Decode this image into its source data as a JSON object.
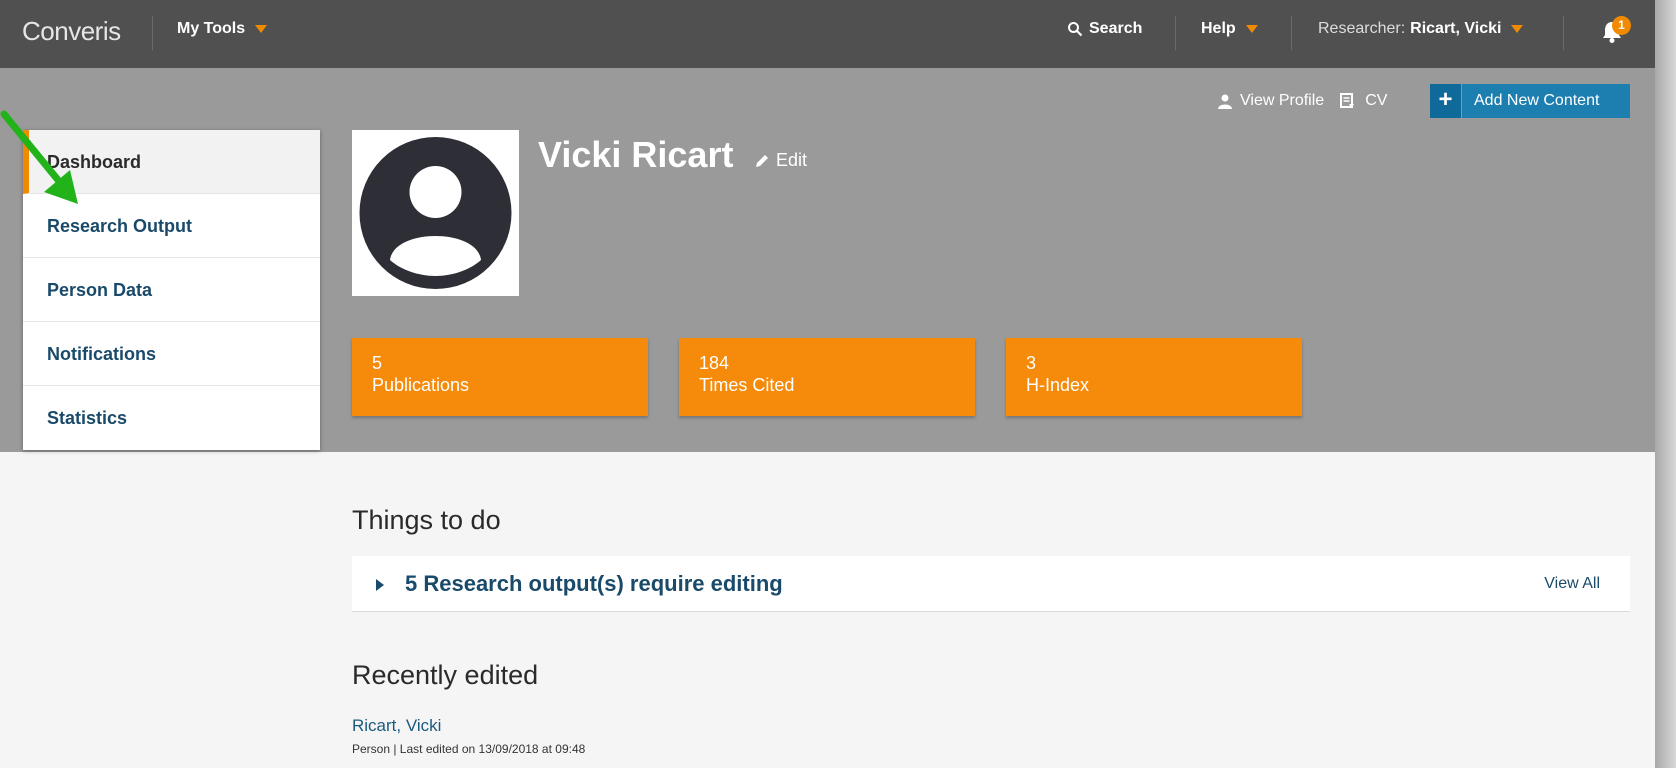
{
  "topbar": {
    "brand": "Converis",
    "my_tools": "My Tools",
    "search": "Search",
    "help": "Help",
    "researcher_label": "Researcher:",
    "researcher_name": "Ricart, Vicki",
    "notification_count": "1"
  },
  "actions": {
    "view_profile": "View Profile",
    "cv": "CV",
    "add_new_content": "Add New Content"
  },
  "sidebar": {
    "items": [
      {
        "label": "Dashboard"
      },
      {
        "label": "Research Output"
      },
      {
        "label": "Person Data"
      },
      {
        "label": "Notifications"
      },
      {
        "label": "Statistics"
      }
    ]
  },
  "profile": {
    "name": "Vicki Ricart",
    "edit_label": "Edit"
  },
  "stats": [
    {
      "value": "5",
      "label": "Publications"
    },
    {
      "value": "184",
      "label": "Times Cited"
    },
    {
      "value": "3",
      "label": "H-Index"
    }
  ],
  "things_to_do": {
    "title": "Things to do",
    "item": "5 Research output(s) require editing",
    "view_all": "View All"
  },
  "recently_edited": {
    "title": "Recently edited",
    "name": "Ricart, Vicki",
    "meta": "Person | Last edited on 13/09/2018 at 09:48"
  },
  "colors": {
    "accent": "#f08a00",
    "topbar": "#505050",
    "band": "#9a9a9a",
    "link": "#1a4a6a",
    "button": "#1d7fb0"
  }
}
